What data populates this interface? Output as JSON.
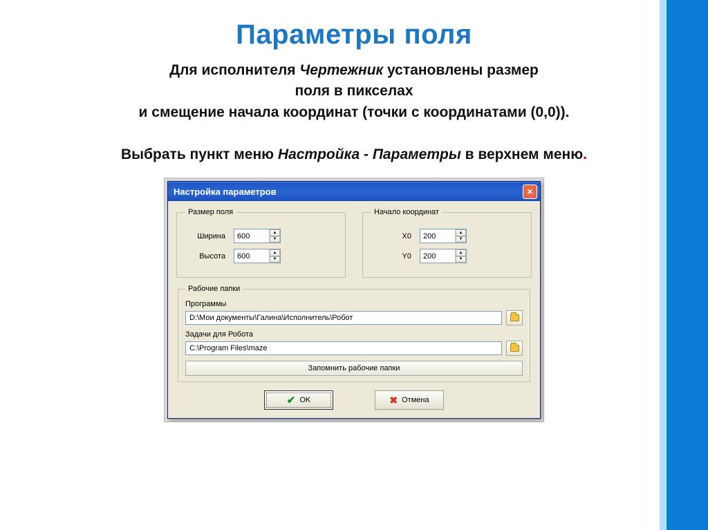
{
  "slide": {
    "title": "Параметры поля",
    "line1_a": "Для исполнителя ",
    "line1_em": "Чертежник",
    "line1_b": "  установлены размер",
    "line2": "поля в пикселах",
    "line3": "и смещение начала координат (точки с координатами (0,0)).",
    "line4_a": "Выбрать пункт меню ",
    "line4_em": "Настройка - Параметры",
    "line4_b": " в верхнем меню",
    "line4_dot": "."
  },
  "dialog": {
    "title": "Настройка параметров",
    "group_size": {
      "legend": "Размер поля",
      "width_label": "Ширина",
      "width_value": "600",
      "height_label": "Высота",
      "height_value": "600"
    },
    "group_origin": {
      "legend": "Начало координат",
      "x_label": "X0",
      "x_value": "200",
      "y_label": "Y0",
      "y_value": "200"
    },
    "group_folders": {
      "legend": "Рабочие папки",
      "programs_label": "Программы",
      "programs_path": "D:\\Мои документы\\Галина\\Исполнитель\\Робот",
      "tasks_label": "Задачи для Робота",
      "tasks_path": "C:\\Program Files\\maze",
      "remember": "Запомнить рабочие папки"
    },
    "buttons": {
      "ok": "OK",
      "cancel": "Отмена"
    }
  }
}
